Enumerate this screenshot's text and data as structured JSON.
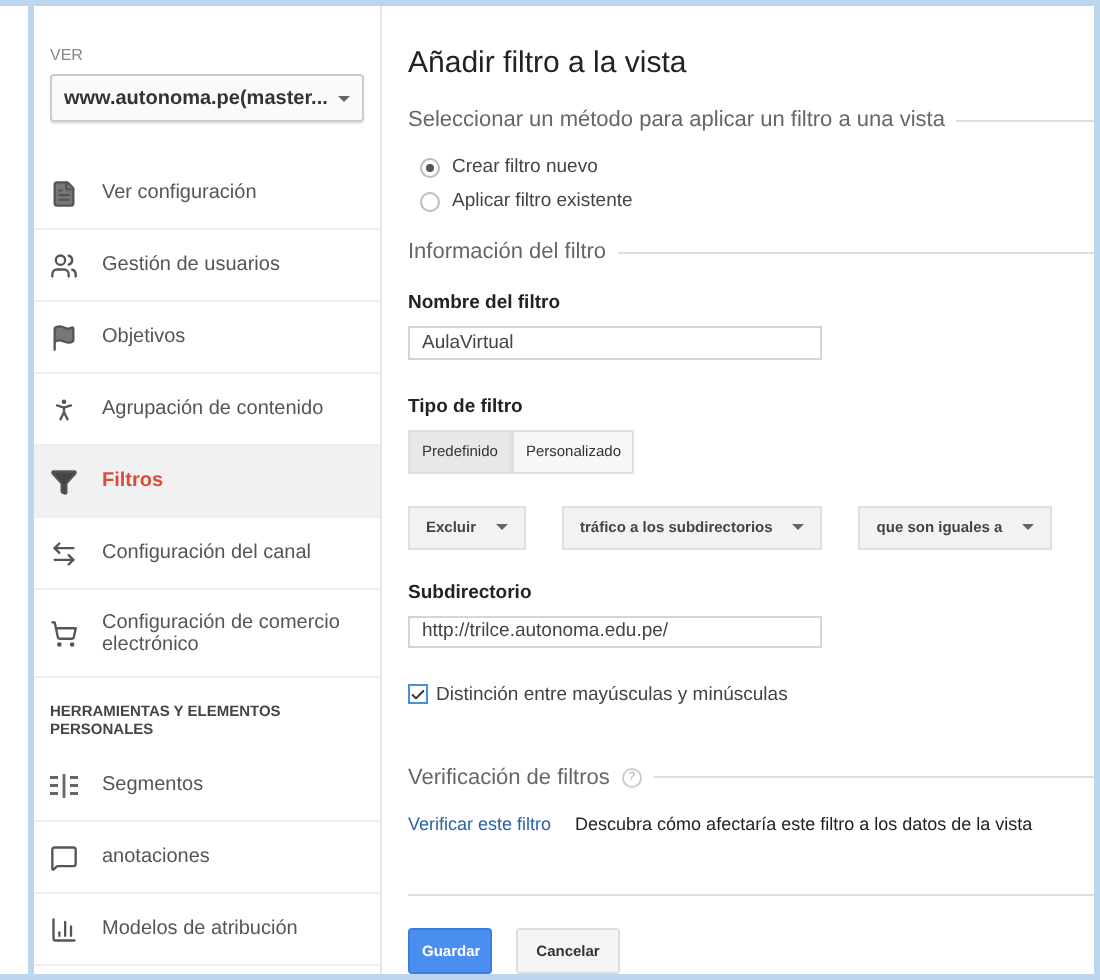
{
  "sidebar": {
    "view_label": "VER",
    "view_select": "www.autonoma.pe(master...",
    "items": [
      {
        "label": "Ver configuración",
        "kind": "document",
        "selected": false
      },
      {
        "label": "Gestión de usuarios",
        "kind": "people",
        "selected": false
      },
      {
        "label": "Objetivos",
        "kind": "flag",
        "selected": false
      },
      {
        "label": "Agrupación de contenido",
        "kind": "person",
        "selected": false
      },
      {
        "label": "Filtros",
        "kind": "filter",
        "selected": true
      },
      {
        "label": "Configuración del canal",
        "kind": "channel",
        "selected": false
      },
      {
        "label": "Configuración de comercio electrónico",
        "kind": "cart",
        "selected": false
      }
    ],
    "section_header": "HERRAMIENTAS Y ELEMENTOS PERSONALES",
    "tool_items": [
      {
        "label": "Segmentos",
        "kind": "segments",
        "selected": false
      },
      {
        "label": "anotaciones",
        "kind": "comment",
        "selected": false
      },
      {
        "label": "Modelos de atribución",
        "kind": "bars",
        "selected": false
      }
    ]
  },
  "main": {
    "title": "Añadir filtro a la vista",
    "method_legend": "Seleccionar un método para aplicar un filtro a una vista",
    "method_options": [
      {
        "label": "Crear filtro nuevo",
        "selected": true
      },
      {
        "label": "Aplicar filtro existente",
        "selected": false
      }
    ],
    "info_legend": "Información del filtro",
    "name_label": "Nombre del filtro",
    "name_value": "AulaVirtual",
    "type_label": "Tipo de filtro",
    "type_tabs": [
      {
        "label": "Predefinido",
        "selected": true
      },
      {
        "label": "Personalizado",
        "selected": false
      }
    ],
    "dropdowns": [
      "Excluir",
      "tráfico a los subdirectorios",
      "que son iguales a"
    ],
    "subdir_label": "Subdirectorio",
    "subdir_value": "http://trilce.autonoma.edu.pe/",
    "case_checkbox": {
      "label": "Distinción entre mayúsculas y minúsculas",
      "checked": true
    },
    "verify_legend": "Verificación de filtros",
    "verify_help": "?",
    "verify_link": "Verificar este filtro",
    "verify_text": "Descubra cómo afectaría este filtro a los datos de la vista",
    "buttons": [
      {
        "label": "Guardar",
        "kind": "primary"
      },
      {
        "label": "Cancelar",
        "kind": "secondary"
      }
    ]
  }
}
